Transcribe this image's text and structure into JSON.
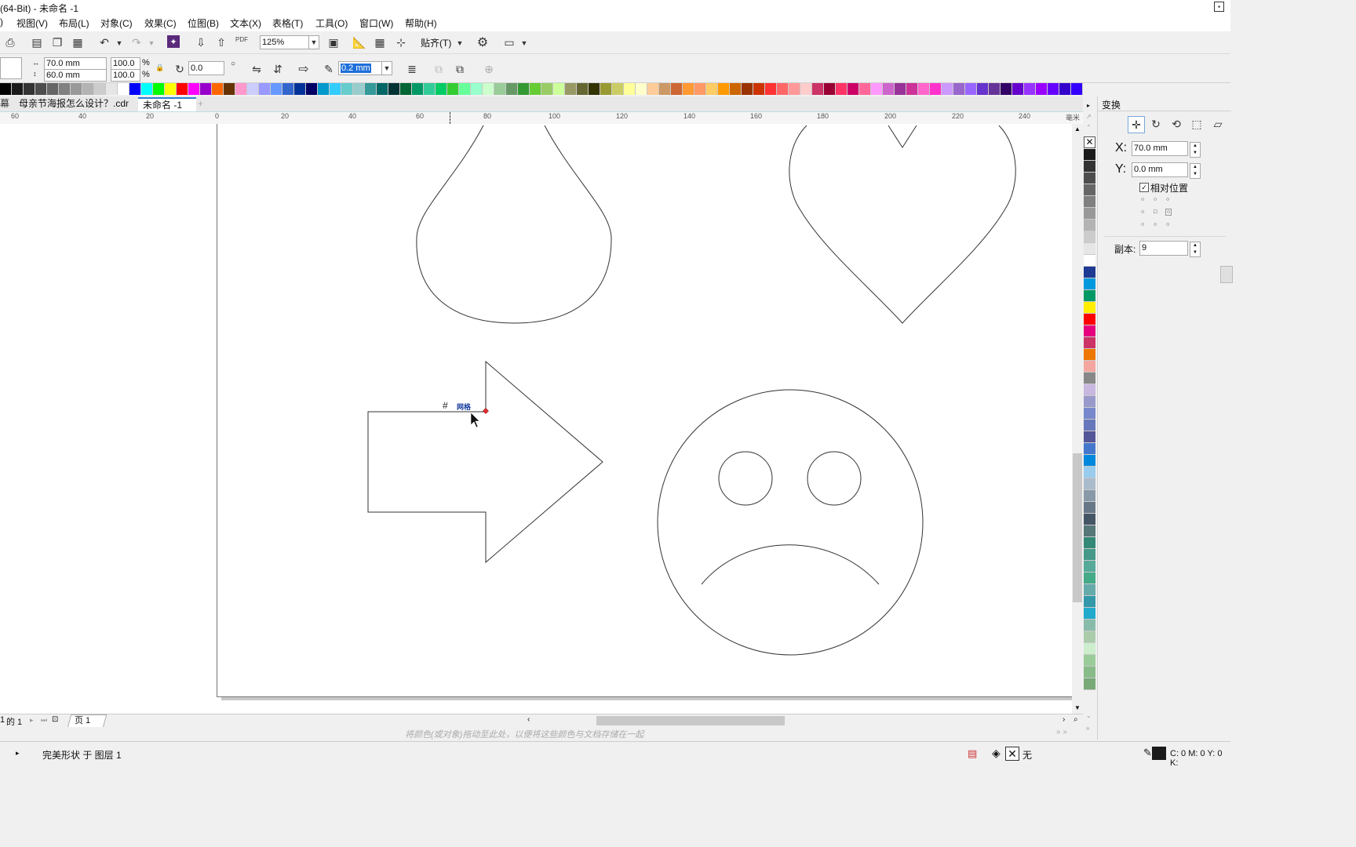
{
  "window": {
    "title": "(64-Bit) - 未命名 -1"
  },
  "menu": {
    "items": [
      ")",
      "视图(V)",
      "布局(L)",
      "对象(C)",
      "效果(C)",
      "位图(B)",
      "文本(X)",
      "表格(T)",
      "工具(O)",
      "窗口(W)",
      "帮助(H)"
    ]
  },
  "toolbar": {
    "zoom": "125%",
    "snap_label": "贴齐(T)",
    "pdf_label": "PDF"
  },
  "propbar": {
    "width": "70.0 mm",
    "height": "60.0 mm",
    "scale_x": "100.0",
    "scale_y": "100.0",
    "percent": "%",
    "rotation": "0.0",
    "outline_width": "0.2 mm"
  },
  "palette": {
    "colors": [
      "#000000",
      "#1a1a1a",
      "#333333",
      "#4d4d4d",
      "#666666",
      "#808080",
      "#999999",
      "#b3b3b3",
      "#cccccc",
      "#e6e6e6",
      "#ffffff",
      "#0000ff",
      "#00ffff",
      "#00ff00",
      "#ffff00",
      "#ff0000",
      "#ff00ff",
      "#9900cc",
      "#ff6600",
      "#663300",
      "#ff99cc",
      "#ccccff",
      "#9999ff",
      "#6699ff",
      "#3366cc",
      "#003399",
      "#000066",
      "#0099cc",
      "#33ccff",
      "#66cccc",
      "#99cccc",
      "#339999",
      "#006666",
      "#003333",
      "#006633",
      "#009966",
      "#33cc99",
      "#00cc66",
      "#33cc33",
      "#66ff99",
      "#99ffcc",
      "#ccffcc",
      "#99cc99",
      "#669966",
      "#339933",
      "#66cc33",
      "#99cc66",
      "#ccff99",
      "#999966",
      "#666633",
      "#333300",
      "#999933",
      "#cccc66",
      "#ffff99",
      "#ffffcc",
      "#ffcc99",
      "#cc9966",
      "#cc6633",
      "#ff9933",
      "#ff9966",
      "#ffcc66",
      "#ff9900",
      "#cc6600",
      "#993300",
      "#cc3300",
      "#ff3333",
      "#ff6666",
      "#ff9999",
      "#ffcccc",
      "#cc3366",
      "#990033",
      "#ff3366",
      "#cc0066",
      "#ff6699",
      "#ff99ff",
      "#cc66cc",
      "#993399",
      "#cc3399",
      "#ff66cc",
      "#ff33cc",
      "#cc99ff",
      "#9966cc",
      "#9966ff",
      "#6633cc",
      "#663399",
      "#330066",
      "#6600cc",
      "#9933ff",
      "#9900ff",
      "#6600ff",
      "#3300cc",
      "#3300ff"
    ]
  },
  "vpalette": {
    "colors": [
      "#1a1a1a",
      "#333333",
      "#4d4d4d",
      "#666666",
      "#808080",
      "#999999",
      "#b3b3b3",
      "#cccccc",
      "#e6e6e6",
      "#ffffff",
      "#1f3a93",
      "#0099dd",
      "#009966",
      "#ffee00",
      "#ff0000",
      "#e6007e",
      "#cc3366",
      "#ee7700",
      "#f4a6a0",
      "#888888",
      "#c8b8e0",
      "#9999cc",
      "#7788cc",
      "#6677bb",
      "#555599",
      "#4477cc",
      "#0088dd",
      "#99ccee",
      "#aabbcc",
      "#8899aa",
      "#667788",
      "#445566",
      "#557777",
      "#338877",
      "#449988",
      "#55aa99",
      "#44aa88",
      "#66aaaa",
      "#3399aa",
      "#22aacc",
      "#88bbaa",
      "#aaccaa",
      "#cceecc",
      "#99cc99",
      "#88bb88",
      "#77aa77"
    ]
  },
  "tabs": {
    "first": "母亲节海报怎么设计？.cdr",
    "second": "未命名 -1",
    "partial": "幕"
  },
  "ruler": {
    "ticks": [
      "60",
      "40",
      "20",
      "0",
      "20",
      "40",
      "60",
      "80",
      "100",
      "120",
      "140",
      "160",
      "180",
      "200",
      "220",
      "240"
    ],
    "unit": "毫米"
  },
  "canvas": {
    "snap_label": "网格"
  },
  "docker": {
    "title": "变换",
    "x_label": "X:",
    "x_value": "70.0 mm",
    "y_label": "Y:",
    "y_value": "0.0 mm",
    "relative_label": "相对位置",
    "copies_label": "副本:",
    "copies_value": "9"
  },
  "pagebar": {
    "page_of": "的 1",
    "page_num": "1",
    "page_tab": "页 1"
  },
  "hint": {
    "text": "将颜色(或对象)拖动至此处，以便将这些颜色与文档存储在一起"
  },
  "status": {
    "left": "完美形状 于 图层 1",
    "fill_none": "无",
    "color_values": "C: 0 M: 0 Y: 0 K:"
  }
}
